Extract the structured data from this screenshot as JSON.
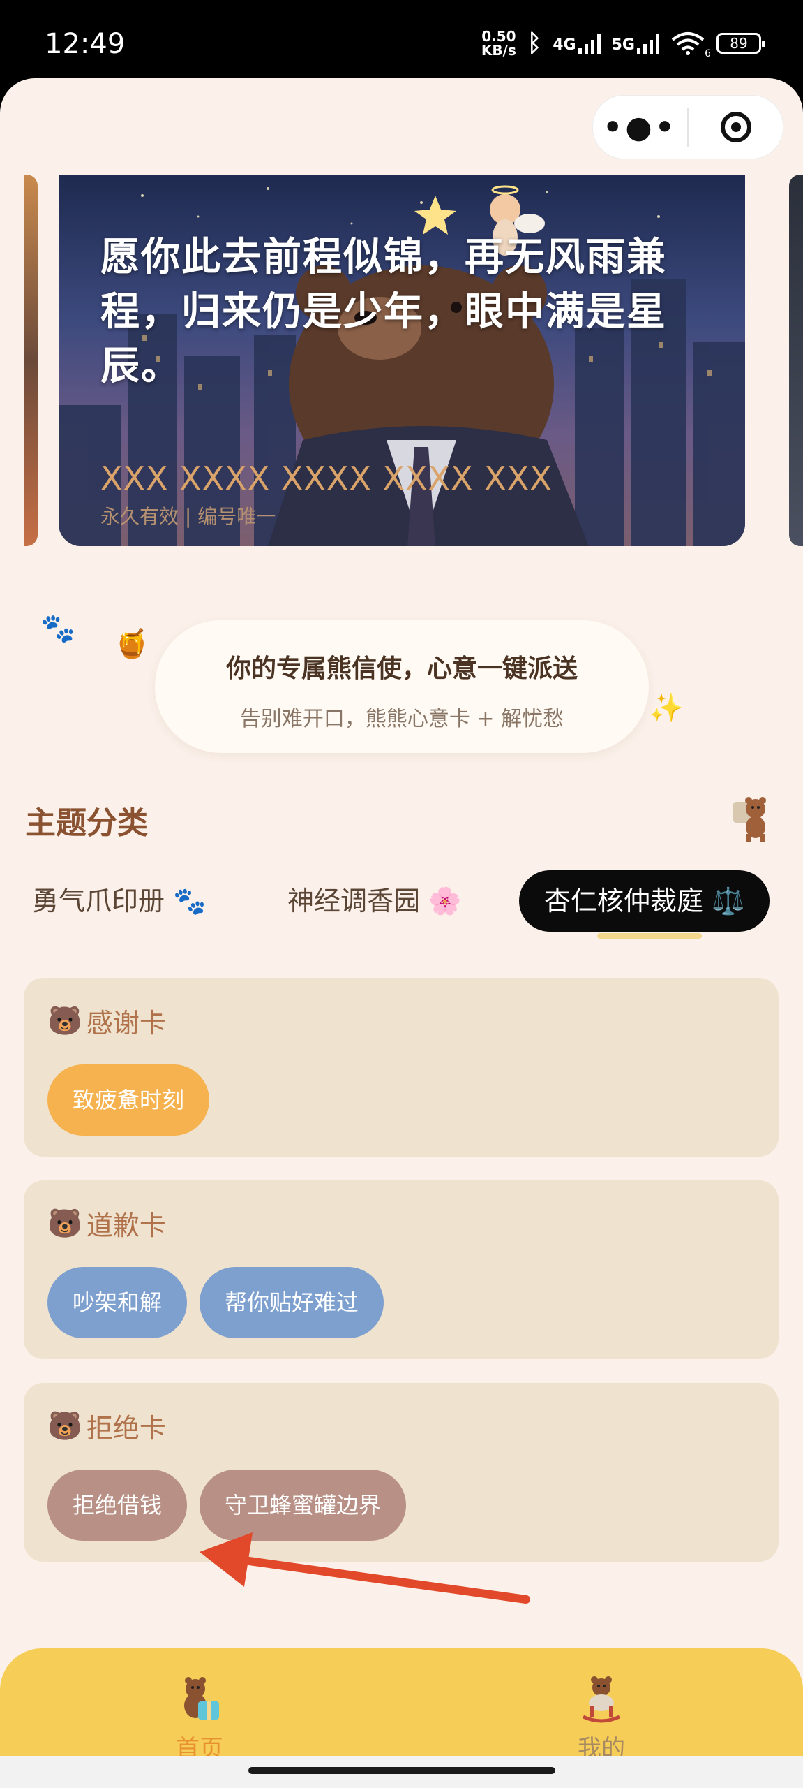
{
  "status_bar": {
    "time": "12:49",
    "net_speed_value": "0.50",
    "net_speed_unit": "KB/s",
    "signal1": "4G",
    "signal2": "5G",
    "wifi_sub": "6",
    "battery": "89"
  },
  "banner": {
    "quote": "愿你此去前程似锦，再无风雨兼程，归来仍是少年，眼中满是星辰。",
    "code": "XXX XXXX XXXX XXXX XXX",
    "meta": "永久有效 | 编号唯一"
  },
  "intro": {
    "title": "你的专属熊信使，心意一键派送",
    "subtitle": "告别难开口，熊熊心意卡 + 解忧愁"
  },
  "section": {
    "title": "主题分类"
  },
  "tabs": [
    {
      "label": "勇气爪印册 🐾"
    },
    {
      "label": "神经调香园 🌸"
    },
    {
      "label": "杏仁核仲裁庭 ⚖️"
    }
  ],
  "cards": [
    {
      "title": "感谢卡",
      "chips": [
        {
          "label": "致疲惫时刻",
          "color": "#f5b24f"
        }
      ]
    },
    {
      "title": "道歉卡",
      "chips": [
        {
          "label": "吵架和解",
          "color": "#7ea0cf"
        },
        {
          "label": "帮你贴好难过",
          "color": "#7ea0cf"
        }
      ]
    },
    {
      "title": "拒绝卡",
      "chips": [
        {
          "label": "拒绝借钱",
          "color": "#b89085"
        },
        {
          "label": "守卫蜂蜜罐边界",
          "color": "#b89085"
        }
      ]
    }
  ],
  "tabbar": {
    "home_label": "首页",
    "mine_label": "我的",
    "active_color": "#e8912f",
    "inactive_color": "#a78a62"
  },
  "colors": {
    "page_bg": "#fbf1ea",
    "card_bg": "#efe3d0",
    "accent_title": "#8a5230",
    "annotation_arrow": "#e2492a"
  }
}
